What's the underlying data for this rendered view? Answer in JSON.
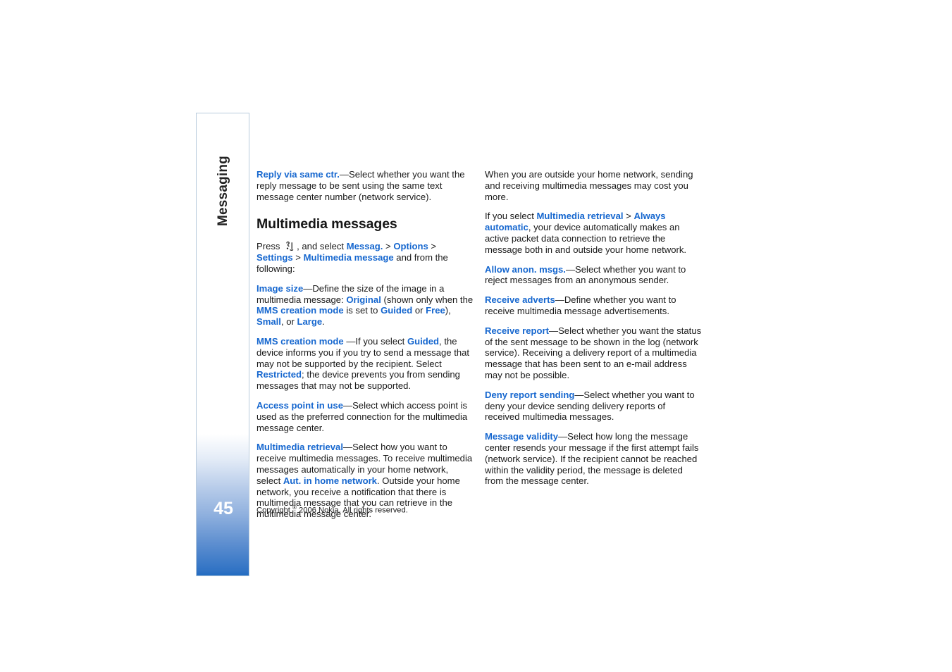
{
  "page": {
    "side_tab_label": "Messaging",
    "page_number": "45",
    "copyright_prefix": "Copyright ",
    "copyright_symbol": "®",
    "copyright_suffix": " 2006 Nokia. All rights reserved."
  },
  "left_column": {
    "p_reply_via": {
      "kw": "Reply via same ctr.",
      "body": "—Select whether you want the reply message to be sent using the same text message center number (network service)."
    },
    "heading": "Multimedia messages",
    "p_press": {
      "t1": "Press ",
      "t2": ", and select ",
      "kw1": "Messag.",
      "sep1": " > ",
      "kw2": "Options",
      "sep2": " > ",
      "kw3": "Settings",
      "sep3": " > ",
      "kw4": "Multimedia message",
      "t3": " and from the following:"
    },
    "p_image_size": {
      "kw": "Image size",
      "t1": "—Define the size of the image in a multimedia message: ",
      "kw2": "Original",
      "t2": " (shown only when the ",
      "kw3": "MMS creation mode",
      "t3": " is set to ",
      "kw4": "Guided",
      "t4": " or ",
      "kw5": "Free",
      "t5": "), ",
      "kw6": "Small",
      "t6": ", or ",
      "kw7": "Large",
      "t7": "."
    },
    "p_mms_mode": {
      "kw": "MMS creation mode ",
      "t1": "—If you select ",
      "kw2": "Guided",
      "t2": ", the device informs you if you try to send a message that may not be supported by the recipient. Select ",
      "kw3": "Restricted",
      "t3": "; the device prevents you from sending messages that may not be supported."
    },
    "p_access_point": {
      "kw": "Access point in use",
      "body": "—Select which access point is used as the preferred connection for the multimedia message center."
    },
    "p_retrieval": {
      "kw": "Multimedia retrieval",
      "t1": "—Select how you want to receive multimedia messages. To receive multimedia messages automatically in your home network, select ",
      "kw2": "Aut. in home network",
      "t2": ". Outside your home network, you receive a notification that there is multimedia message that you can retrieve in the multimedia message center."
    }
  },
  "right_column": {
    "p_outside": "When you are outside your home network, sending and receiving multimedia messages may cost you more.",
    "p_if_you_select": {
      "t1": "If you select ",
      "kw1": "Multimedia retrieval",
      "sep": " > ",
      "kw2": "Always automatic",
      "t2": ", your device automatically makes an active packet data connection to retrieve the message both in and outside your home network."
    },
    "p_allow_anon": {
      "kw": "Allow anon. msgs.",
      "body": "—Select whether you want to reject messages from an anonymous sender."
    },
    "p_receive_adverts": {
      "kw": "Receive adverts",
      "body": "—Define whether you want to receive multimedia message advertisements."
    },
    "p_receive_report": {
      "kw": "Receive report",
      "body": "—Select whether you want the status of the sent message to be shown in the log (network service). Receiving a delivery report of a multimedia message that has been sent to an e-mail address may not be possible."
    },
    "p_deny_report": {
      "kw": "Deny report sending",
      "body": "—Select whether you want to deny your device sending delivery reports of received multimedia messages."
    },
    "p_message_validity": {
      "kw": "Message validity",
      "body": "—Select how long the message center resends your message if the first attempt fails (network service). If the recipient cannot be reached within the validity period, the message is deleted from the message center."
    }
  },
  "colors": {
    "link_blue": "#1667cf",
    "tab_blue": "#1c6ac0",
    "tab_border": "#b9cbdd",
    "text": "#1a1a1a"
  }
}
